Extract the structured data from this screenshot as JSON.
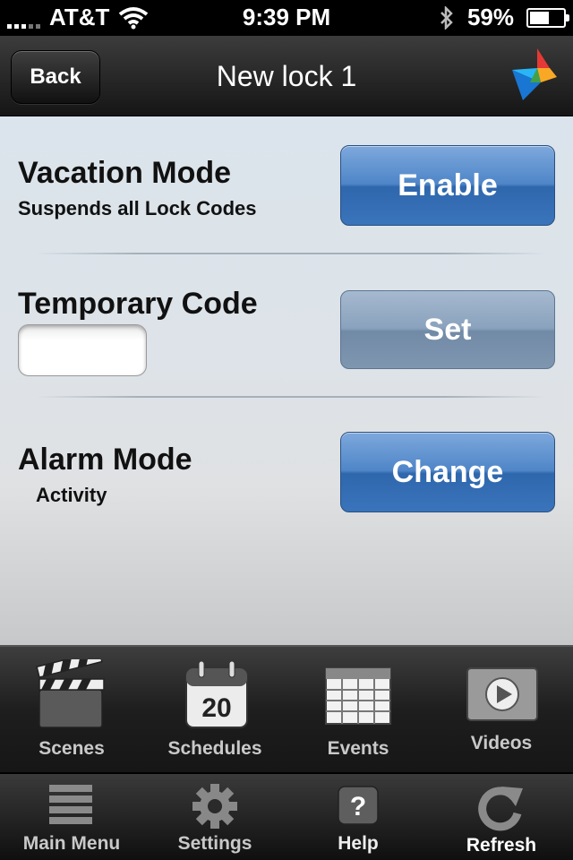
{
  "status_bar": {
    "carrier": "AT&T",
    "time": "9:39 PM",
    "battery": "59%",
    "battery_level": 0.59
  },
  "nav": {
    "back_label": "Back",
    "title": "New lock 1"
  },
  "content": {
    "vacation": {
      "title": "Vacation Mode",
      "subtitle": "Suspends all Lock Codes",
      "button": "Enable"
    },
    "temporary": {
      "title": "Temporary Code",
      "input_value": "",
      "button": "Set"
    },
    "alarm": {
      "title": "Alarm Mode",
      "subtitle": "Activity",
      "button": "Change"
    }
  },
  "tabs_top": [
    {
      "label": "Scenes",
      "icon": "clapperboard-icon"
    },
    {
      "label": "Schedules",
      "icon": "calendar-icon",
      "icon_text": "20"
    },
    {
      "label": "Events",
      "icon": "grid-icon"
    },
    {
      "label": "Videos",
      "icon": "play-icon"
    }
  ],
  "tabs_bottom": [
    {
      "label": "Main Menu",
      "icon": "menu-icon"
    },
    {
      "label": "Settings",
      "icon": "gear-icon"
    },
    {
      "label": "Help",
      "icon": "help-icon",
      "icon_text": "?"
    },
    {
      "label": "Refresh",
      "icon": "refresh-icon"
    }
  ],
  "colors": {
    "accent_blue": "#3a74ba",
    "disabled_blue": "#8aa2bd"
  }
}
